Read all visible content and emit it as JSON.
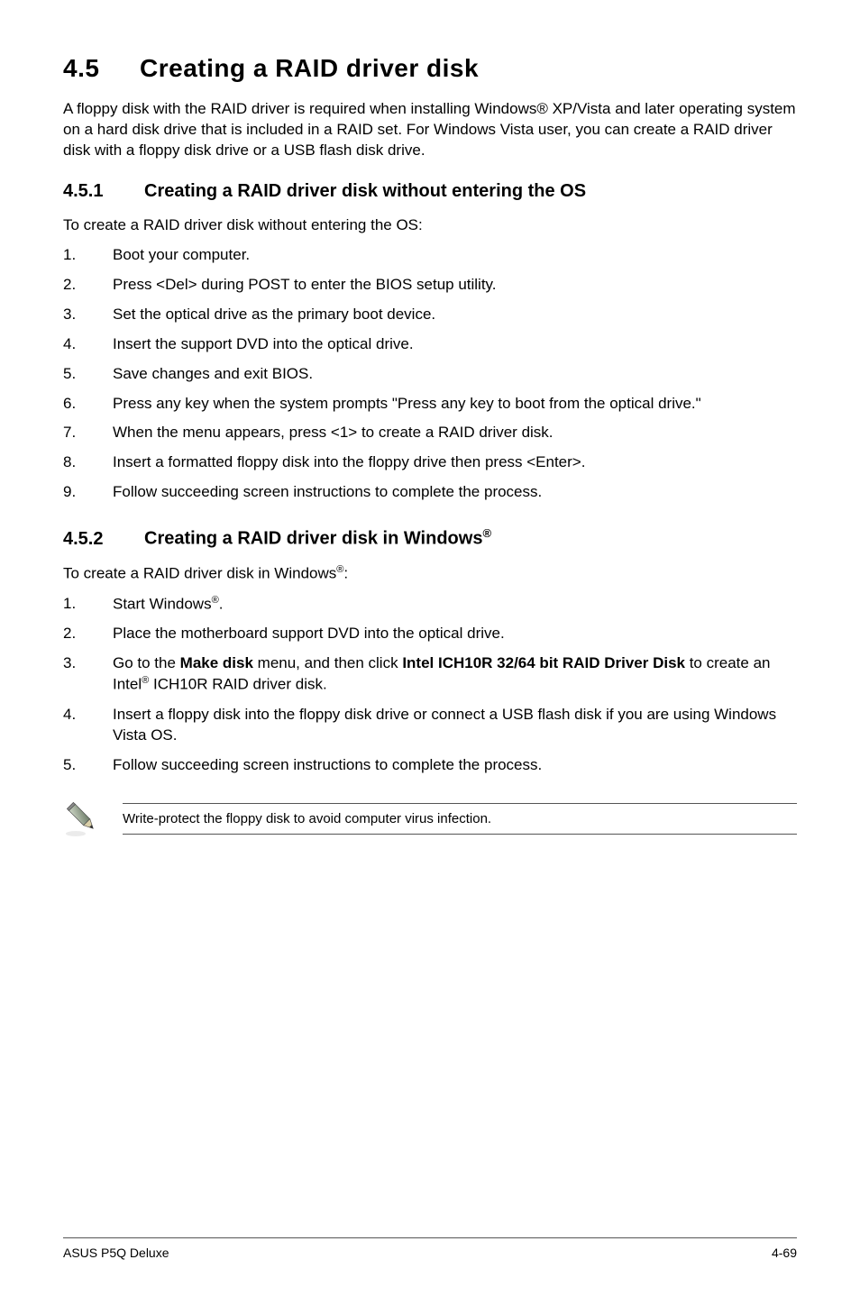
{
  "section": {
    "number": "4.5",
    "title": "Creating a RAID driver disk"
  },
  "intro": "A floppy disk with the RAID driver is required when installing Windows® XP/Vista and later operating system on a hard disk drive that is included in a RAID set. For Windows Vista user, you can create a RAID driver disk with a floppy disk drive or a USB flash disk drive.",
  "sub1": {
    "number": "4.5.1",
    "title": "Creating a RAID driver disk without entering the OS",
    "lead": "To create a RAID driver disk without entering the OS:",
    "steps": [
      "Boot your computer.",
      "Press <Del> during POST to enter the BIOS setup utility.",
      "Set the optical drive as the primary boot device.",
      "Insert the support DVD into the optical drive.",
      "Save changes and exit BIOS.",
      "Press any key when the system prompts \"Press any key to boot from the optical drive.\"",
      "When the menu appears, press <1> to create a RAID driver disk.",
      "Insert a formatted floppy disk into the floppy drive then press <Enter>.",
      "Follow succeeding screen instructions to complete the process."
    ]
  },
  "sub2": {
    "number": "4.5.2",
    "title_prefix": "Creating a RAID driver disk in Windows",
    "title_sup": "®",
    "lead_prefix": "To create a RAID driver disk in Windows",
    "lead_sup": "®",
    "lead_suffix": ":",
    "steps": {
      "s1_prefix": "Start Windows",
      "s1_sup": "®",
      "s1_suffix": ".",
      "s2": "Place the motherboard support DVD into the optical drive.",
      "s3_a": "Go to the ",
      "s3_bold1": "Make disk",
      "s3_b": " menu, and then click ",
      "s3_bold2": "Intel ICH10R 32/64 bit RAID Driver Disk",
      "s3_c": " to create an Intel",
      "s3_sup": "®",
      "s3_d": " ICH10R RAID driver disk.",
      "s4": "Insert a floppy disk into the floppy disk drive or connect a USB flash disk if you are using Windows Vista OS.",
      "s5": "Follow succeeding screen instructions to complete the process."
    }
  },
  "note": "Write-protect the floppy disk to avoid computer virus infection.",
  "footer": {
    "left": "ASUS P5Q Deluxe",
    "right": "4-69"
  }
}
